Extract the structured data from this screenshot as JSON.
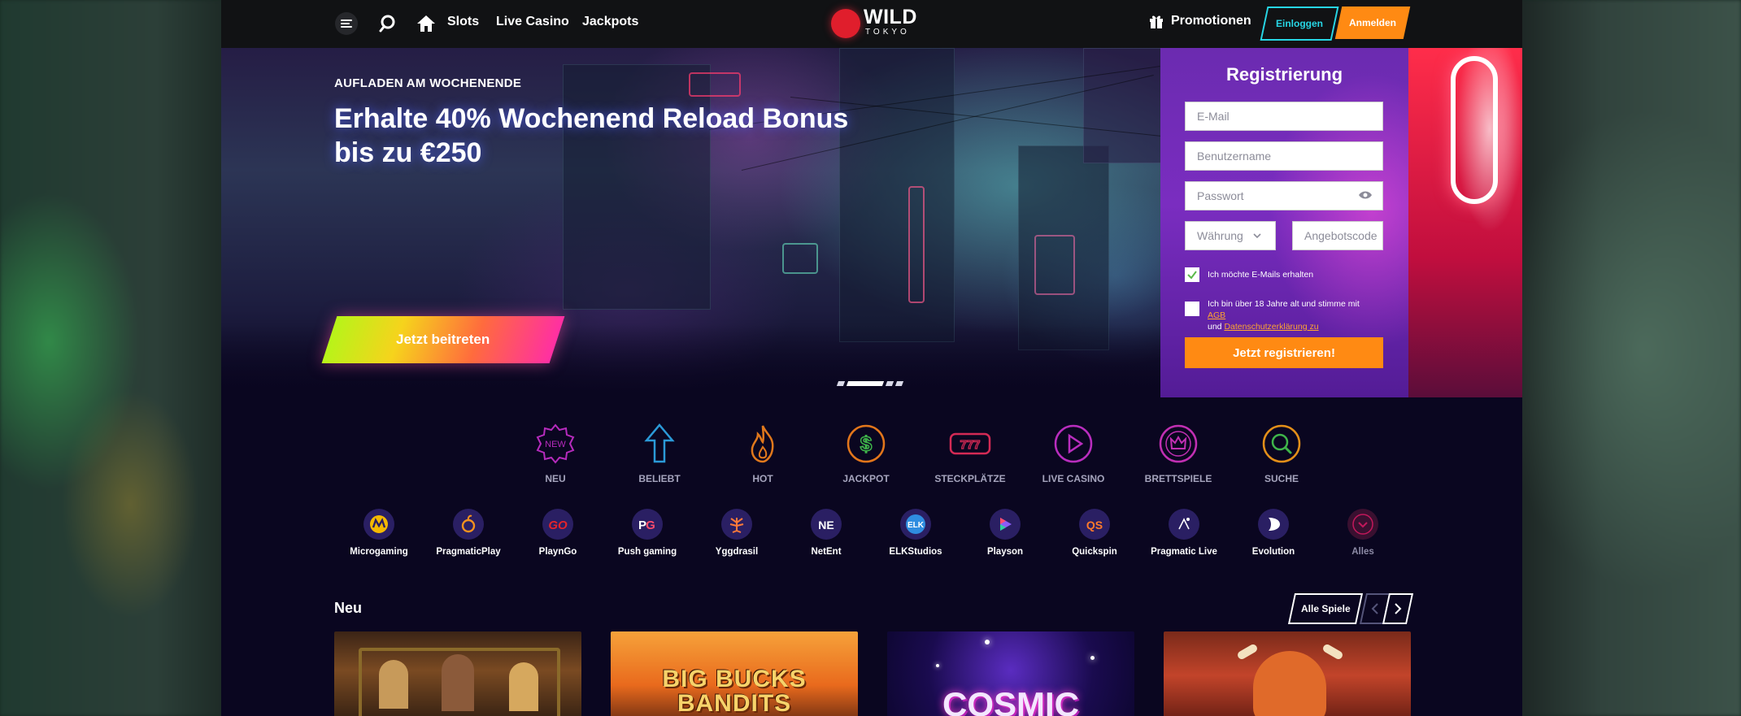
{
  "header": {
    "nav": [
      "Slots",
      "Live Casino",
      "Jackpots"
    ],
    "logo_top": "WILD",
    "logo_bottom": "TOKYO",
    "promotions_label": "Promotionen",
    "login_label": "Einloggen",
    "register_label": "Anmelden"
  },
  "hero": {
    "kicker": "AUFLADEN AM WOCHENENDE",
    "title_line1": "Erhalte 40% Wochenend Reload Bonus",
    "title_line2": "bis zu €250",
    "cta_label": "Jetzt beitreten",
    "slides_total": 4,
    "active_slide": 2
  },
  "registration": {
    "title": "Registrierung",
    "email_placeholder": "E-Mail",
    "username_placeholder": "Benutzername",
    "password_placeholder": "Passwort",
    "currency_placeholder": "Währung",
    "promo_code_placeholder": "Angebotscode",
    "emails_opt_in_label": "Ich möchte E-Mails erhalten",
    "emails_opt_in_checked": true,
    "terms_text_before": "Ich bin über 18 Jahre alt und stimme mit ",
    "terms_link": "AGB",
    "terms_text_and": "und ",
    "privacy_link": "Datenschutzerklärung zu",
    "terms_checked": false,
    "submit_label": "Jetzt registrieren!"
  },
  "categories": [
    {
      "label": "NEU",
      "icon": "new-badge-icon",
      "color": "#b62bbd"
    },
    {
      "label": "BELIEBT",
      "icon": "arrow-up-icon",
      "color": "#2b9ad8"
    },
    {
      "label": "HOT",
      "icon": "flame-icon",
      "color": "#e0781c"
    },
    {
      "label": "JACKPOT",
      "icon": "dollar-coin-icon",
      "color": "#e2761b"
    },
    {
      "label": "STECKPLÄTZE",
      "icon": "slot-777-icon",
      "color": "#d42a55"
    },
    {
      "label": "LIVE CASINO",
      "icon": "play-circle-icon",
      "color": "#b92dbe"
    },
    {
      "label": "BRETTSPIELE",
      "icon": "crown-chip-icon",
      "color": "#c12fb2"
    },
    {
      "label": "SUCHE",
      "icon": "search-icon",
      "color": "#e38f19"
    }
  ],
  "providers": [
    {
      "label": "Microgaming",
      "icon": "microgaming-logo-icon",
      "color": "#f5b900"
    },
    {
      "label": "PragmaticPlay",
      "icon": "pragmaticplay-logo-icon",
      "color": "#f6921e"
    },
    {
      "label": "PlaynGo",
      "icon": "playngo-logo-icon",
      "color": "#e3242b"
    },
    {
      "label": "Push gaming",
      "icon": "pushgaming-logo-icon",
      "color": "#ff4d6d"
    },
    {
      "label": "Yggdrasil",
      "icon": "yggdrasil-logo-icon",
      "color": "#ff7a3a"
    },
    {
      "label": "NetEnt",
      "icon": "netent-logo-icon",
      "color": "#ffffff"
    },
    {
      "label": "ELKStudios",
      "icon": "elkstudios-logo-icon",
      "color": "#2f8de0"
    },
    {
      "label": "Playson",
      "icon": "playson-logo-icon",
      "color": "#8b5cf6"
    },
    {
      "label": "Quickspin",
      "icon": "quickspin-logo-icon",
      "color": "#ff7a2a"
    },
    {
      "label": "Pragmatic Live",
      "icon": "pragmaticlive-logo-icon",
      "color": "#ffffff"
    },
    {
      "label": "Evolution",
      "icon": "evolution-logo-icon",
      "color": "#ffffff"
    },
    {
      "label": "Alles",
      "icon": "chevron-down-icon",
      "color": "#c2185b"
    }
  ],
  "new_games": {
    "title": "Neu",
    "all_games_label": "Alle Spiele",
    "games": [
      {
        "title": "",
        "theme": "jazz-band"
      },
      {
        "title": "BIG BUCKS BANDITS",
        "theme": "western"
      },
      {
        "title": "COSMIC",
        "theme": "space"
      },
      {
        "title": "",
        "theme": "viking-bull"
      }
    ]
  },
  "colors": {
    "accent_orange": "#ff8a13",
    "accent_cyan": "#27d6e5",
    "page_bg": "#0a0620",
    "header_bg": "#111214",
    "link_orange": "#ffa52f"
  }
}
